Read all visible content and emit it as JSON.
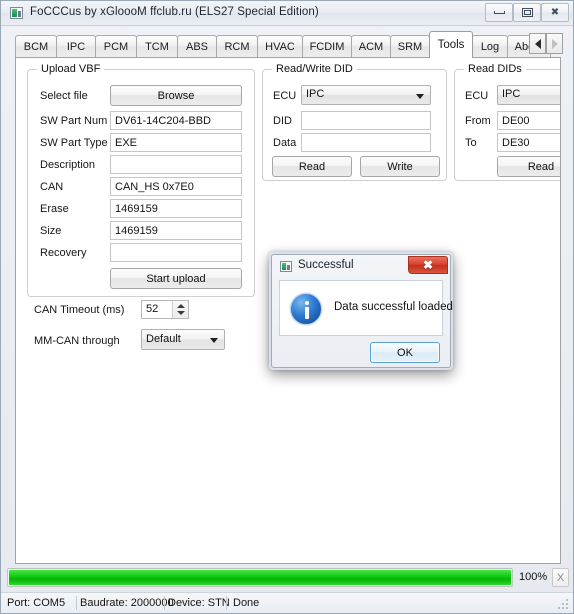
{
  "window": {
    "title": "FoCCCus by xGloooM ffclub.ru (ELS27 Special Edition)",
    "app_icon": "app-window-icon",
    "controls": {
      "minimize": "minimize-icon",
      "maximize": "maximize-icon",
      "close": "close-icon",
      "close_glyph": "✖"
    }
  },
  "tabs": {
    "items": [
      {
        "label": "BCM",
        "active": false
      },
      {
        "label": "IPC",
        "active": false
      },
      {
        "label": "PCM",
        "active": false
      },
      {
        "label": "TCM",
        "active": false
      },
      {
        "label": "ABS",
        "active": false
      },
      {
        "label": "RCM",
        "active": false
      },
      {
        "label": "HVAC",
        "active": false
      },
      {
        "label": "FCDIM",
        "active": false
      },
      {
        "label": "ACM",
        "active": false
      },
      {
        "label": "SRM",
        "active": false
      },
      {
        "label": "Tools",
        "active": true
      },
      {
        "label": "Log",
        "active": false
      },
      {
        "label": "About",
        "active": false
      }
    ],
    "scroll_left": "scroll-left-arrow",
    "scroll_right": "scroll-right-arrow"
  },
  "upload_vbf": {
    "legend": "Upload VBF",
    "fields": [
      {
        "label": "Select file",
        "value": ""
      },
      {
        "label": "SW Part Num",
        "value": "DV61-14C204-BBD"
      },
      {
        "label": "SW Part Type",
        "value": "EXE"
      },
      {
        "label": "Description",
        "value": ""
      },
      {
        "label": "CAN",
        "value": "CAN_HS 0x7E0"
      },
      {
        "label": "Erase",
        "value": "1469159"
      },
      {
        "label": "Size",
        "value": "1469159"
      },
      {
        "label": "Recovery",
        "value": ""
      }
    ],
    "browse_button": "Browse",
    "start_upload_button": "Start upload"
  },
  "read_write_did": {
    "legend": "Read/Write DID",
    "ecu_label": "ECU",
    "ecu_value": "IPC",
    "did_label": "DID",
    "did_value": "",
    "data_label": "Data",
    "data_value": "",
    "read_button": "Read",
    "write_button": "Write"
  },
  "read_dids": {
    "legend": "Read DIDs",
    "ecu_label": "ECU",
    "ecu_value": "IPC",
    "from_label": "From",
    "from_value": "DE00",
    "to_label": "To",
    "to_value": "DE30",
    "read_button": "Read"
  },
  "settings": {
    "can_timeout_label": "CAN Timeout (ms)",
    "can_timeout_value": "52",
    "mm_can_label": "MM-CAN through",
    "mm_can_value": "Default"
  },
  "progress": {
    "percent": 100,
    "percent_label": "100%",
    "cancel_label": "X",
    "fill_color": "#16cc16"
  },
  "statusbar": {
    "port": "Port: COM5",
    "baudrate": "Baudrate: 2000000",
    "device": "Device: STN",
    "state": "Done"
  },
  "dialog": {
    "title": "Successful",
    "icon": "dialog-window-icon",
    "info_icon": "information-icon",
    "message": "Data successful loaded",
    "ok_button": "OK",
    "close_glyph": "✖"
  }
}
